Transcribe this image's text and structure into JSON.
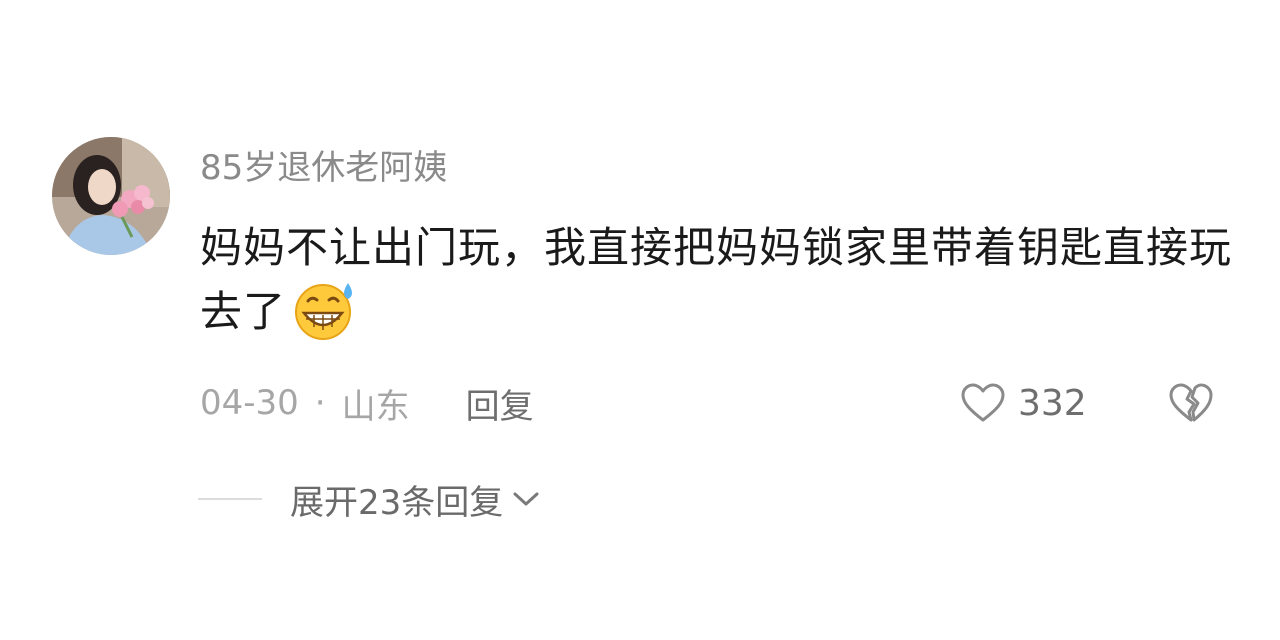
{
  "comment": {
    "username": "85岁退休老阿姨",
    "text": "妈妈不让出门玩，我直接把妈妈锁家里带着钥匙直接玩去了",
    "emoji": "sweat-grinning-emoji",
    "date": "04-30",
    "separator": "·",
    "location": "山东",
    "reply_label": "回复",
    "like_count": "332",
    "expand_replies_label": "展开23条回复"
  },
  "icons": {
    "like": "heart-outline-icon",
    "dislike": "broken-heart-icon",
    "expand": "chevron-down-icon"
  },
  "colors": {
    "username": "#8a8a8a",
    "text": "#1a1a1a",
    "meta": "#a6a6a6",
    "action": "#6e6e6e"
  }
}
